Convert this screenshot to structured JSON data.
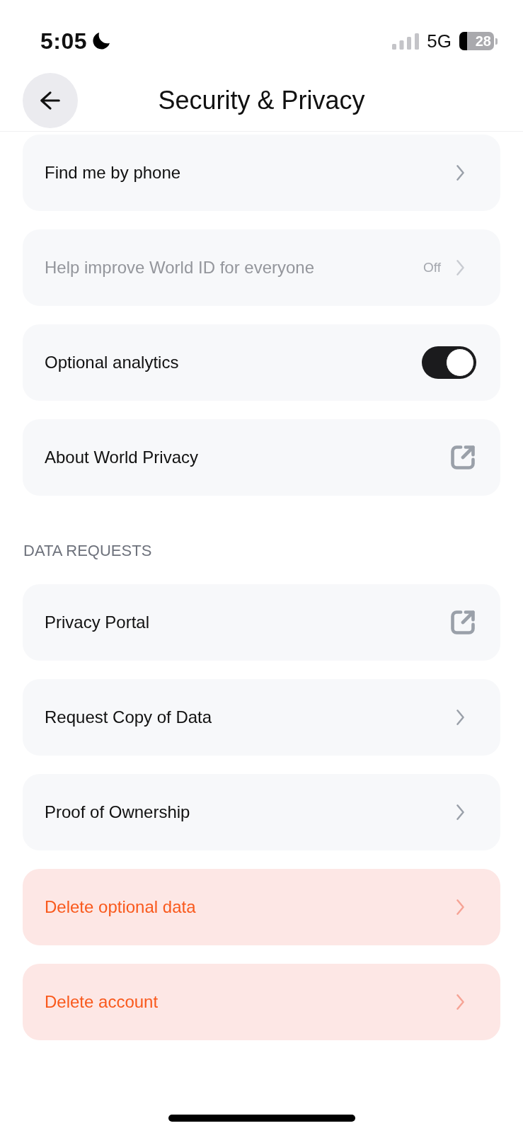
{
  "status_bar": {
    "time": "5:05",
    "network": "5G",
    "battery": "28"
  },
  "header": {
    "title": "Security & Privacy"
  },
  "sections": [
    {
      "items": [
        {
          "label": "Find me by phone",
          "kind": "chevron",
          "disabled": false,
          "destructive": false
        },
        {
          "label": "Help improve World ID for everyone",
          "kind": "chevron",
          "value": "Off",
          "disabled": true,
          "destructive": false
        },
        {
          "label": "Optional analytics",
          "kind": "toggle",
          "on": true,
          "disabled": false,
          "destructive": false
        },
        {
          "label": "About World Privacy",
          "kind": "external",
          "disabled": false,
          "destructive": false
        }
      ]
    },
    {
      "heading": "DATA REQUESTS",
      "items": [
        {
          "label": "Privacy Portal",
          "kind": "external",
          "disabled": false,
          "destructive": false
        },
        {
          "label": "Request Copy of Data",
          "kind": "chevron",
          "disabled": false,
          "destructive": false
        },
        {
          "label": "Proof of Ownership",
          "kind": "chevron",
          "disabled": false,
          "destructive": false
        },
        {
          "label": "Delete optional data",
          "kind": "chevron",
          "disabled": false,
          "destructive": true
        },
        {
          "label": "Delete account",
          "kind": "chevron",
          "disabled": false,
          "destructive": true
        }
      ]
    }
  ]
}
